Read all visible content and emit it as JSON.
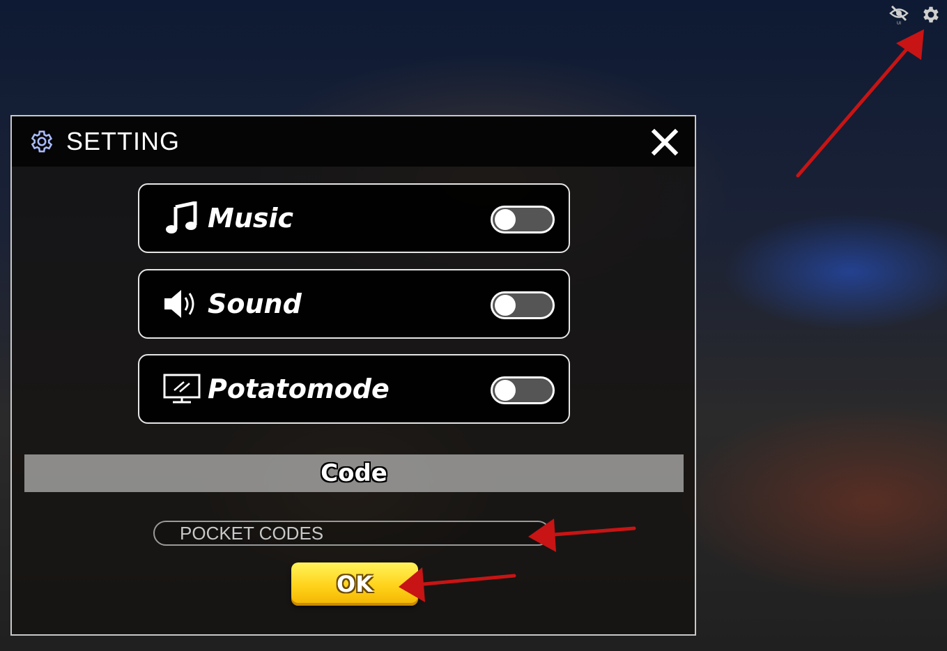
{
  "top_bar": {
    "hide_ui_icon": "eye-slash-icon",
    "hide_ui_caption": "UI",
    "settings_icon": "gear-icon"
  },
  "settings_panel": {
    "title": "SETTING",
    "title_icon": "gear-outline-icon",
    "close_icon": "close-x-icon",
    "options": [
      {
        "label": "Music",
        "icon": "music-note-icon",
        "enabled": false
      },
      {
        "label": "Sound",
        "icon": "speaker-icon",
        "enabled": false
      },
      {
        "label": "Potatomode",
        "icon": "monitor-icon",
        "enabled": false
      }
    ],
    "code_section": {
      "header": "Code",
      "input_placeholder": "POCKET CODES",
      "input_value": "",
      "submit_label": "OK"
    }
  },
  "colors": {
    "annotation_arrow": "#c81414",
    "title_icon": "#9fb6ff",
    "ok_button": "#ffd21a"
  }
}
